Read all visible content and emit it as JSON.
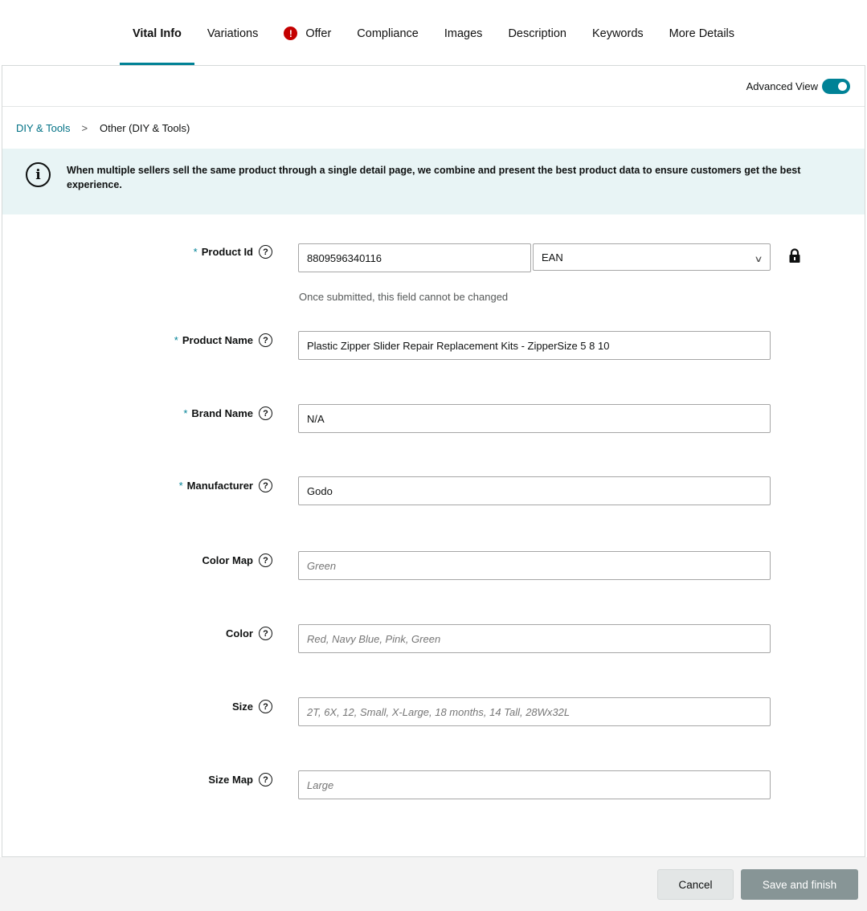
{
  "tabs": [
    {
      "label": "Vital Info",
      "active": true,
      "warning": false
    },
    {
      "label": "Variations",
      "active": false,
      "warning": false
    },
    {
      "label": "Offer",
      "active": false,
      "warning": true
    },
    {
      "label": "Compliance",
      "active": false,
      "warning": false
    },
    {
      "label": "Images",
      "active": false,
      "warning": false
    },
    {
      "label": "Description",
      "active": false,
      "warning": false
    },
    {
      "label": "Keywords",
      "active": false,
      "warning": false
    },
    {
      "label": "More Details",
      "active": false,
      "warning": false
    }
  ],
  "advanced_view": {
    "label": "Advanced View",
    "enabled": true
  },
  "breadcrumb": {
    "root": "DIY & Tools",
    "separator": ">",
    "current": "Other (DIY & Tools)"
  },
  "info_banner": {
    "icon": "info-icon",
    "text": "When multiple sellers sell the same product through a single detail page, we combine and present the best product data to ensure customers get the best experience."
  },
  "fields": {
    "product_id": {
      "label": "Product Id",
      "required": "*",
      "value": "8809596340116",
      "type_value": "EAN",
      "hint": "Once submitted, this field cannot be changed"
    },
    "product_name": {
      "label": "Product Name",
      "required": "*",
      "value": "Plastic Zipper Slider Repair Replacement Kits - ZipperSize 5 8 10"
    },
    "brand_name": {
      "label": "Brand Name",
      "required": "*",
      "value": "N/A"
    },
    "manufacturer": {
      "label": "Manufacturer",
      "required": "*",
      "value": "Godo"
    },
    "color_map": {
      "label": "Color Map",
      "placeholder": "Green"
    },
    "color": {
      "label": "Color",
      "placeholder": "Red, Navy Blue, Pink, Green"
    },
    "size": {
      "label": "Size",
      "placeholder": "2T, 6X, 12, Small, X-Large, 18 months, 14 Tall, 28Wx32L"
    },
    "size_map": {
      "label": "Size Map",
      "placeholder": "Large"
    }
  },
  "help_glyph": "?",
  "footer": {
    "cancel_label": "Cancel",
    "save_label": "Save and finish"
  },
  "colors": {
    "accent": "#008296",
    "warning": "#c40000",
    "banner": "#e8f4f5",
    "save_button": "#879596"
  }
}
